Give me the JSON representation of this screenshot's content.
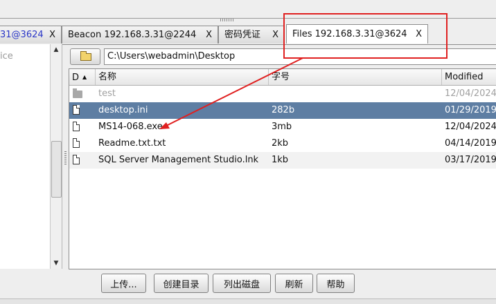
{
  "tabs": [
    {
      "label": "31@3624",
      "close": "X"
    },
    {
      "label": "Beacon 192.168.3.31@2244",
      "close": "X"
    },
    {
      "label": "密码凭证",
      "close": "X"
    },
    {
      "label": "Files 192.168.3.31@3624",
      "close": "X"
    }
  ],
  "left_pane": {
    "text": "ice"
  },
  "path": {
    "value": "C:\\Users\\webadmin\\Desktop"
  },
  "table": {
    "headers": {
      "d": "D",
      "name": "名称",
      "size": "字号",
      "modified": "Modified"
    },
    "rows": [
      {
        "type": "folder",
        "name": "test",
        "size": "",
        "modified": "12/04/2024"
      },
      {
        "type": "file",
        "name": "desktop.ini",
        "size": "282b",
        "modified": "01/29/2019"
      },
      {
        "type": "file",
        "name": "MS14-068.exe",
        "size": "3mb",
        "modified": "12/04/2024"
      },
      {
        "type": "file",
        "name": "Readme.txt.txt",
        "size": "2kb",
        "modified": "04/14/2019"
      },
      {
        "type": "file",
        "name": "SQL Server Management Studio.lnk",
        "size": "1kb",
        "modified": "03/17/2019"
      }
    ]
  },
  "buttons": {
    "upload": "上传...",
    "mkdir": "创建目录",
    "list_drives": "列出磁盘",
    "refresh": "刷新",
    "help": "帮助"
  },
  "colors": {
    "selection": "#5e7ea3",
    "annotation": "#e02020",
    "tab_link": "#2a36c7"
  }
}
